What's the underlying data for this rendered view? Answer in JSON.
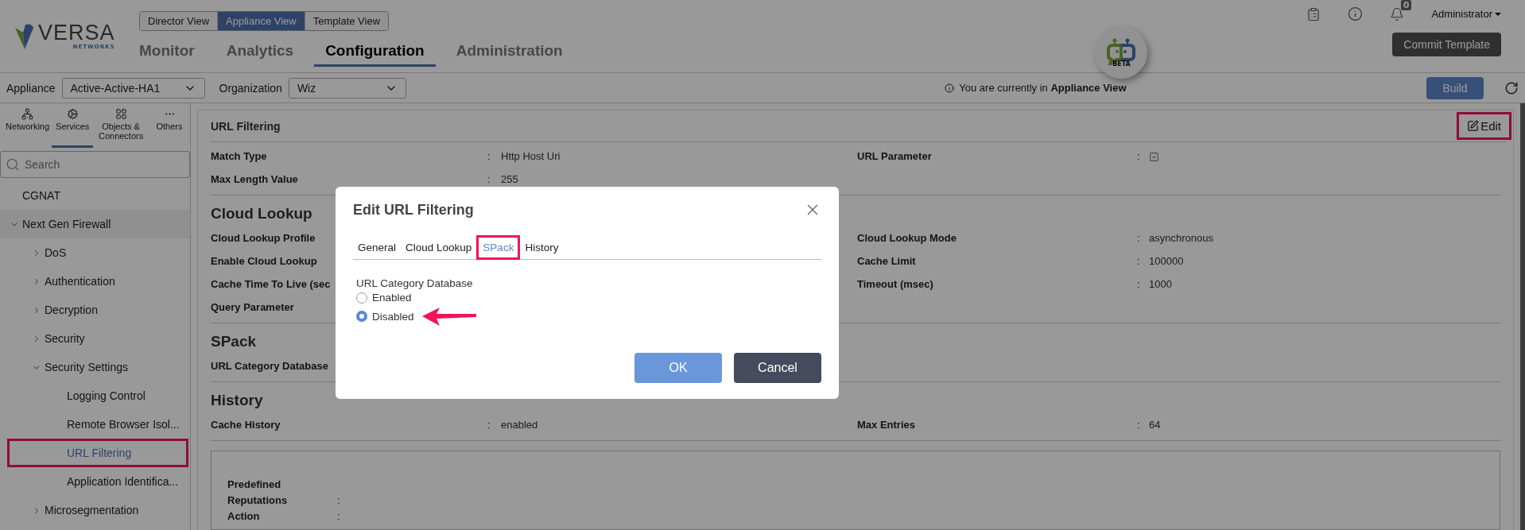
{
  "logo": {
    "name": "VERSA",
    "tagline": "NETWORKS"
  },
  "view_switch": [
    {
      "label": "Director View",
      "selected": false
    },
    {
      "label": "Appliance View",
      "selected": true
    },
    {
      "label": "Template View",
      "selected": false
    }
  ],
  "nav_tabs": [
    {
      "label": "Monitor",
      "selected": false
    },
    {
      "label": "Analytics",
      "selected": false
    },
    {
      "label": "Configuration",
      "selected": true
    },
    {
      "label": "Administration",
      "selected": false
    }
  ],
  "assistant_badge": "BETA",
  "notifications": {
    "count": "0"
  },
  "user_menu": "Administrator",
  "commit_button": "Commit Template",
  "toolbar": {
    "appliance_label": "Appliance",
    "appliance_value": "Active-Active-HA1",
    "organization_label": "Organization",
    "organization_value": "Wiz",
    "notice": "You are currently in **Appliance View**",
    "build_button": "Build"
  },
  "sidebar": {
    "tabs": [
      {
        "kind": "network",
        "label": "Networking",
        "selected": false
      },
      {
        "kind": "gears",
        "label": "Services",
        "selected": true
      },
      {
        "kind": "grid",
        "label": "Objects & Connectors",
        "selected": false
      },
      {
        "kind": "dots",
        "label": "Others",
        "selected": false
      }
    ],
    "search": {
      "placeholder": "Search"
    },
    "tree": [
      {
        "label": "CGNAT",
        "selected": false,
        "highlighted": false
      },
      {
        "label": "Next Gen Firewall",
        "selected": false,
        "highlighted": false,
        "expanded": true,
        "children": [
          {
            "label": "DoS",
            "selected": false,
            "highlighted": false,
            "expanded": false
          },
          {
            "label": "Authentication",
            "selected": false,
            "highlighted": false,
            "expanded": false
          },
          {
            "label": "Decryption",
            "selected": false,
            "highlighted": false,
            "expanded": false
          },
          {
            "label": "Security",
            "selected": false,
            "highlighted": false,
            "expanded": false
          },
          {
            "label": "Security Settings",
            "selected": false,
            "highlighted": false,
            "expanded": true,
            "children": [
              {
                "label": "Logging Control",
                "selected": false,
                "highlighted": false
              },
              {
                "label": "Remote Browser Isol...",
                "selected": false,
                "highlighted": false
              },
              {
                "label": "URL Filtering",
                "selected": true,
                "highlighted": true
              },
              {
                "label": "Application Identifica...",
                "selected": false,
                "highlighted": false
              }
            ]
          },
          {
            "label": "Microsegmentation",
            "selected": false,
            "highlighted": false,
            "expanded": false
          }
        ]
      }
    ]
  },
  "panel": {
    "title": "URL Filtering",
    "edit_button": {
      "label": "Edit",
      "highlighted": true
    },
    "sections": [
      {
        "rows": [
          {
            "left": {
              "label": "Match Type",
              "colon": ":",
              "value": "Http Host Uri"
            },
            "right": {
              "label": "URL Parameter",
              "colon": ":",
              "kind": "checkbox",
              "checked": true
            }
          },
          {
            "left": {
              "label": "Max Length Value",
              "colon": ":",
              "value": "255"
            }
          }
        ]
      },
      {
        "title": "Cloud Lookup",
        "rows": [
          {
            "left": {
              "label": "Cloud Lookup Profile"
            },
            "right": {
              "label": "Cloud Lookup Mode",
              "colon": ":",
              "kind": "text",
              "value": "asynchronous"
            }
          },
          {
            "left": {
              "label": "Enable Cloud Lookup"
            },
            "right": {
              "label": "Cache Limit",
              "colon": ":",
              "kind": "text",
              "value": "100000"
            }
          },
          {
            "left": {
              "label": "Cache Time To Live (sec"
            },
            "right": {
              "label": "Timeout (msec)",
              "colon": ":",
              "kind": "text",
              "value": "1000"
            }
          },
          {
            "left": {
              "label": "Query Parameter"
            }
          }
        ]
      },
      {
        "title": "SPack",
        "rows": [
          {
            "left": {
              "label": "URL Category Database"
            }
          }
        ]
      },
      {
        "title": "History",
        "rows": [
          {
            "left": {
              "label": "Cache History",
              "colon": ":",
              "value": "enabled"
            },
            "right": {
              "label": "Max Entries",
              "colon": ":",
              "kind": "text",
              "value": "64"
            }
          }
        ]
      }
    ],
    "predefined": {
      "title": "Predefined",
      "rows": [
        {
          "label": "Reputations",
          "colon": ":"
        },
        {
          "label": "Action",
          "colon": ":"
        }
      ]
    }
  },
  "dialog": {
    "title": "Edit URL Filtering",
    "tabs": [
      {
        "label": "General",
        "selected": false,
        "highlighted": false
      },
      {
        "label": "Cloud Lookup",
        "selected": false,
        "highlighted": false
      },
      {
        "label": "SPack",
        "selected": true,
        "highlighted": true
      },
      {
        "label": "History",
        "selected": false,
        "highlighted": false
      }
    ],
    "field_label": "URL Category Database",
    "options": [
      {
        "label": "Enabled",
        "selected": false,
        "pointed": false
      },
      {
        "label": "Disabled",
        "selected": true,
        "pointed": true
      }
    ],
    "buttons": [
      {
        "kind": "primary",
        "label": "OK"
      },
      {
        "kind": "secondary",
        "label": "Cancel"
      }
    ]
  }
}
